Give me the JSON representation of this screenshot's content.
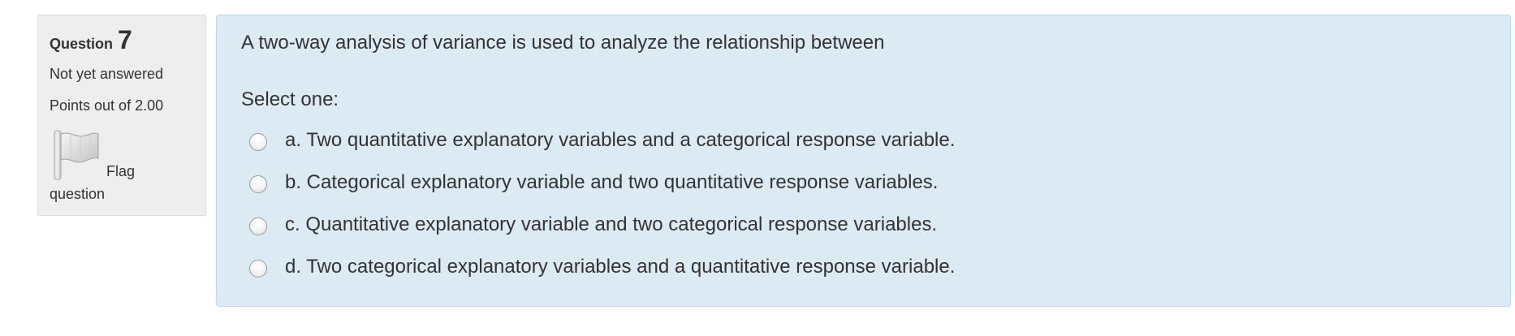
{
  "info": {
    "question_label": "Question",
    "question_number": "7",
    "state": "Not yet answered",
    "grade": "Points out of 2.00",
    "flag_text_1": "Flag",
    "flag_text_2": "question",
    "flag_icon": "flag-icon"
  },
  "question": {
    "text": "A two-way analysis of variance is used to analyze the relationship between",
    "prompt": "Select one:",
    "options": [
      {
        "label": "a. Two quantitative explanatory variables and a categorical response variable.",
        "selected": false
      },
      {
        "label": "b. Categorical explanatory variable and two quantitative response variables.",
        "selected": false
      },
      {
        "label": "c. Quantitative explanatory variable and two categorical response variables.",
        "selected": false
      },
      {
        "label": "d. Two categorical explanatory variables and a quantitative response variable.",
        "selected": false
      }
    ]
  },
  "colors": {
    "info_bg": "#eeeeee",
    "content_bg": "#dceaf4",
    "content_border": "#b8dce8",
    "text": "#333333"
  }
}
